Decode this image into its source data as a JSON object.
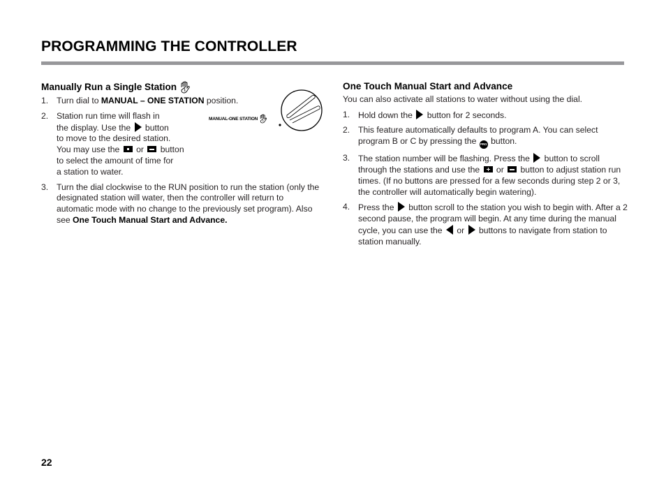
{
  "header": {
    "title": "PROGRAMMING THE CONTROLLER"
  },
  "left_section": {
    "heading": "Manually Run a Single Station",
    "heading_icon": "hand-one-icon",
    "steps": [
      {
        "num": "1.",
        "pre": "Turn dial to ",
        "bold": "MANUAL – ONE STATION",
        "post": " position."
      },
      {
        "num": "2.",
        "line1": "Station run time will flash in",
        "line2_pre": "the display. Use the ",
        "line2_post": " button",
        "line3": "to move to the desired station.",
        "line4_pre": "You may use the ",
        "line4_mid": " or ",
        "line4_post": " button",
        "line5": "to select the amount of time for",
        "line6": "a station to water."
      },
      {
        "num": "3.",
        "text": "Turn the dial clockwise to the RUN position to run the station (only the designated station will water, then the controller will return to automatic mode with no change to the previously set program). Also see ",
        "bold": "One Touch Manual Start and Advance."
      }
    ],
    "dial_figure": {
      "label": "MANUAL-ONE STATION",
      "icon": "hand-one-icon"
    }
  },
  "right_section": {
    "heading": "One Touch Manual Start and Advance",
    "intro": "You can also activate all stations to water without using the dial.",
    "steps": [
      {
        "num": "1.",
        "pre": "Hold down the ",
        "post": " button for 2 seconds."
      },
      {
        "num": "2.",
        "pre": "This feature automatically defaults to program A. You can select program B or C by pressing the ",
        "post": " button.",
        "button_label": "PRG"
      },
      {
        "num": "3.",
        "pre": "The station number will be flashing. Press the ",
        "mid1": " button to scroll through the stations and use the ",
        "mid2": " or ",
        "post": " button to adjust station run times. (If no buttons are pressed for a few seconds during step 2 or 3, the controller will automatically begin watering)."
      },
      {
        "num": "4.",
        "pre": "Press the ",
        "mid1": " button scroll to the station you wish to begin with. After a 2 second pause, the program will begin. At any time during the manual cycle, you can use the ",
        "mid2": " or ",
        "post": " buttons to navigate from station to station manually."
      }
    ]
  },
  "footer": {
    "page_number": "22"
  }
}
